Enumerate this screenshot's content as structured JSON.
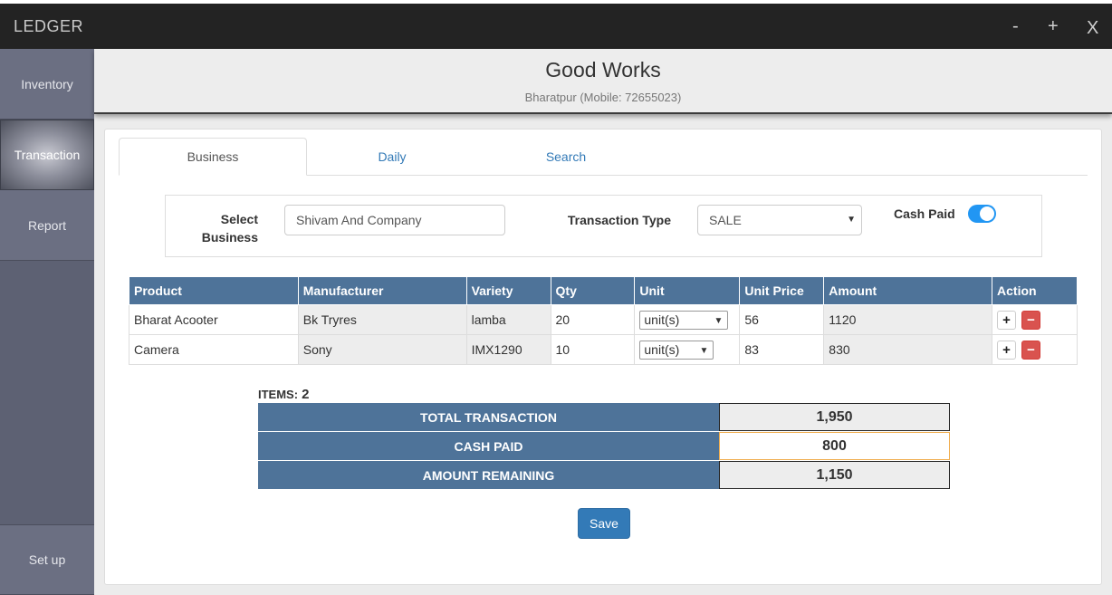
{
  "app": {
    "title": "LEDGER",
    "window_controls": [
      "-",
      "+",
      "X"
    ]
  },
  "sidebar": {
    "items": [
      {
        "label": "Inventory",
        "active": false
      },
      {
        "label": "Transaction",
        "active": true
      },
      {
        "label": "Report",
        "active": false
      },
      {
        "label": "Set up",
        "active": false
      }
    ]
  },
  "header": {
    "company": "Good Works",
    "subtitle": "Bharatpur (Mobile: 72655023)"
  },
  "tabs": [
    {
      "label": "Business",
      "active": true
    },
    {
      "label": "Daily",
      "active": false
    },
    {
      "label": "Search",
      "active": false
    }
  ],
  "form": {
    "select_business_label_1": "Select",
    "select_business_label_2": "Business",
    "business_value": "Shivam And Company",
    "transaction_type_label": "Transaction Type",
    "transaction_type_value": "SALE",
    "cash_paid_label": "Cash Paid",
    "cash_paid_on": true
  },
  "table": {
    "columns": [
      "Product",
      "Manufacturer",
      "Variety",
      "Qty",
      "Unit",
      "Unit Price",
      "Amount",
      "Action"
    ],
    "rows": [
      {
        "product": "Bharat Acooter",
        "manufacturer": "Bk Tryres",
        "variety": "lamba",
        "qty": "20",
        "unit": "unit(s)",
        "unit_price": "56",
        "amount": "1120"
      },
      {
        "product": "Camera",
        "manufacturer": "Sony",
        "variety": "IMX1290",
        "qty": "10",
        "unit": "unit(s)",
        "unit_price": "83",
        "amount": "830"
      }
    ],
    "add_glyph": "+",
    "remove_glyph": "−"
  },
  "summary": {
    "items_label": "ITEMS:",
    "items_count": "2",
    "total_label": "TOTAL TRANSACTION",
    "total_value": "1,950",
    "cash_label": "CASH PAID",
    "cash_value": "800",
    "remaining_label": "AMOUNT REMAINING",
    "remaining_value": "1,150"
  },
  "actions": {
    "save_label": "Save"
  },
  "colors": {
    "titlebar": "#232323",
    "sidebar": "#5d6173",
    "table_header": "#4e7399",
    "primary": "#337ab7",
    "danger": "#d9534f",
    "toggle": "#2196f3"
  }
}
